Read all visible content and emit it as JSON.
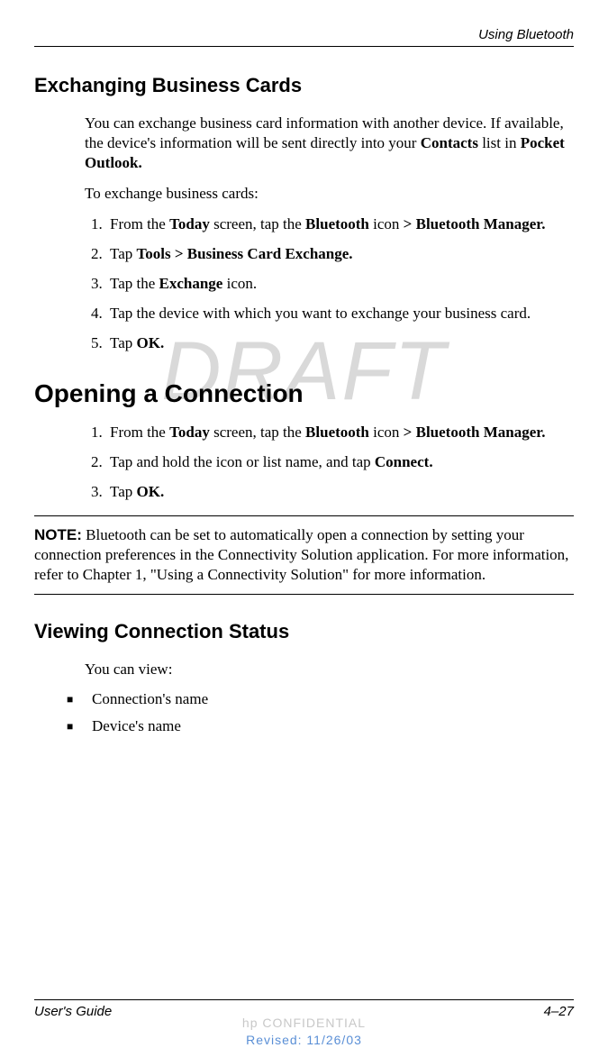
{
  "header": {
    "chapter": "Using Bluetooth"
  },
  "watermark": "DRAFT",
  "section1": {
    "title": "Exchanging Business Cards",
    "intro_parts": {
      "p1": "You can exchange business card information with another device. If available, the device's information will be sent directly into your ",
      "b1": "Contacts",
      "p2": " list in ",
      "b2": "Pocket Outlook."
    },
    "lead": "To exchange business cards:",
    "steps": {
      "s1": {
        "p1": "From the ",
        "b1": "Today",
        "p2": " screen, tap the ",
        "b2": "Bluetooth",
        "p3": " icon ",
        "b3": "> Bluetooth Manager."
      },
      "s2": {
        "p1": "Tap ",
        "b1": "Tools > Business Card Exchange."
      },
      "s3": {
        "p1": "Tap the ",
        "b1": "Exchange",
        "p2": " icon."
      },
      "s4": {
        "p1": "Tap the device with which you want to exchange your business card."
      },
      "s5": {
        "p1": "Tap ",
        "b1": "OK."
      }
    }
  },
  "section2": {
    "title": "Opening a Connection",
    "steps": {
      "s1": {
        "p1": "From the ",
        "b1": "Today",
        "p2": " screen, tap the ",
        "b2": "Bluetooth",
        "p3": " icon ",
        "b3": "> Bluetooth Manager."
      },
      "s2": {
        "p1": "Tap and hold the icon or list name, and tap ",
        "b1": "Connect."
      },
      "s3": {
        "p1": "Tap ",
        "b1": "OK."
      }
    },
    "note": {
      "label": "NOTE:",
      "text": " Bluetooth can be set to automatically open a connection by setting your connection preferences in the Connectivity Solution application. For more information, refer to Chapter 1, \"Using a Connectivity Solution\" for more information."
    }
  },
  "section3": {
    "title": "Viewing Connection Status",
    "lead": "You can view:",
    "bullets": {
      "b1": "Connection's name",
      "b2": "Device's name"
    }
  },
  "footer": {
    "left": "User's Guide",
    "right": "4–27"
  },
  "confidential": {
    "line1": "hp CONFIDENTIAL",
    "line2": "Revised: 11/26/03"
  }
}
